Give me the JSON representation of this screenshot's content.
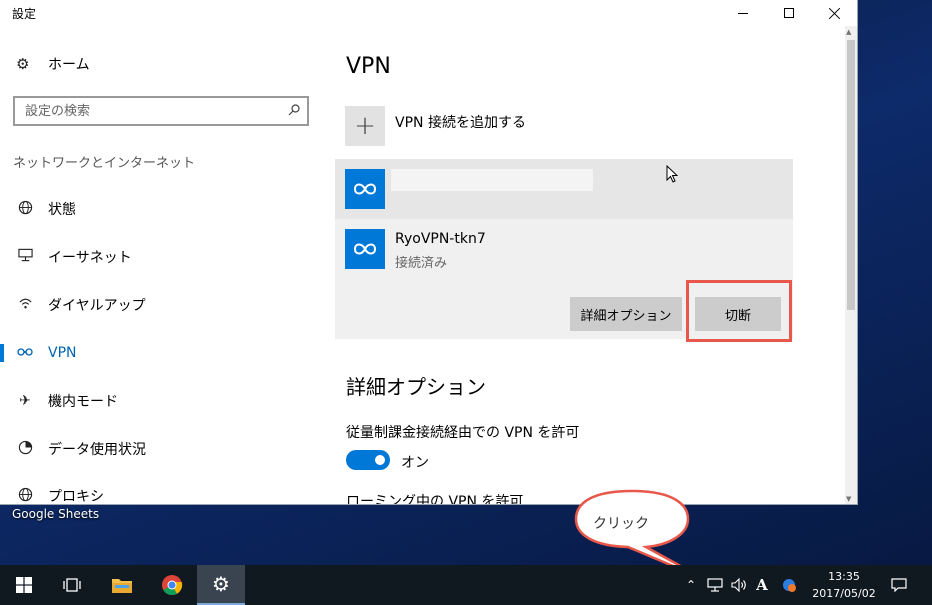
{
  "window": {
    "title": "設定"
  },
  "sidebar": {
    "home_label": "ホーム",
    "search_placeholder": "設定の検索",
    "section_label": "ネットワークとインターネット",
    "items": [
      {
        "label": "状態",
        "icon": "globe-icon"
      },
      {
        "label": "イーサネット",
        "icon": "ethernet-icon"
      },
      {
        "label": "ダイヤルアップ",
        "icon": "dialup-icon"
      },
      {
        "label": "VPN",
        "icon": "vpn-icon",
        "active": true
      },
      {
        "label": "機内モード",
        "icon": "airplane-icon"
      },
      {
        "label": "データ使用状況",
        "icon": "data-usage-icon"
      },
      {
        "label": "プロキシ",
        "icon": "proxy-icon"
      }
    ]
  },
  "main": {
    "title": "VPN",
    "add_label": "VPN 接続を追加する",
    "connection": {
      "name": "RyoVPN-tkn7",
      "status": "接続済み",
      "advanced_button": "詳細オプション",
      "disconnect_button": "切断"
    },
    "advanced_title": "詳細オプション",
    "metered_label": "従量制課金接続経由での VPN を許可",
    "metered_state": "オン",
    "roaming_label": "ローミング中の VPN を許可"
  },
  "desktop": {
    "shortcut_label": "Google Sheets"
  },
  "callout": {
    "text": "クリック"
  },
  "taskbar": {
    "time": "13:35",
    "date": "2017/05/02",
    "ime": "A"
  },
  "colors": {
    "accent": "#0078d7",
    "highlight": "#e8584a"
  }
}
